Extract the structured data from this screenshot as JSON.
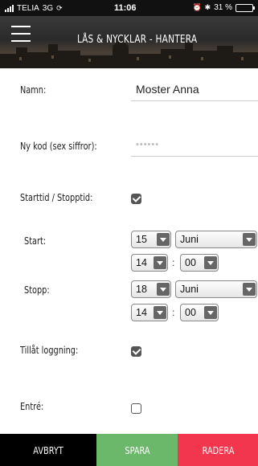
{
  "status_bar": {
    "carrier": "TELIA",
    "network": "3G",
    "time": "11:06",
    "battery_text": "31 %",
    "battery_level": 0.31,
    "battery_color": "#4cd964"
  },
  "header": {
    "menu_icon": "hamburger-menu-icon",
    "title": "LÅS & NYCKLAR - HANTERA"
  },
  "form": {
    "name": {
      "label": "Namn:",
      "value": "Moster Anna"
    },
    "code": {
      "label": "Ny kod (sex siffror):",
      "placeholder": "••••••"
    },
    "start_stop": {
      "label": "Starttid / Stopptid:",
      "checked": true
    },
    "start": {
      "label": "Start:",
      "day": "15",
      "month": "Juni",
      "hour": "14",
      "separator": ":",
      "minute": "00"
    },
    "stop": {
      "label": "Stopp:",
      "day": "18",
      "month": "Juni",
      "hour": "14",
      "separator": ":",
      "minute": "00"
    },
    "logging": {
      "label": "Tillåt loggning:",
      "checked": true
    },
    "entry": {
      "label": "Entré:",
      "checked": false
    }
  },
  "footer": {
    "cancel": "AVBRYT",
    "save": "SPARA",
    "delete": "RADERA",
    "cancel_color": "#000000",
    "save_color": "#6bb86b",
    "delete_color": "#f2364e"
  }
}
